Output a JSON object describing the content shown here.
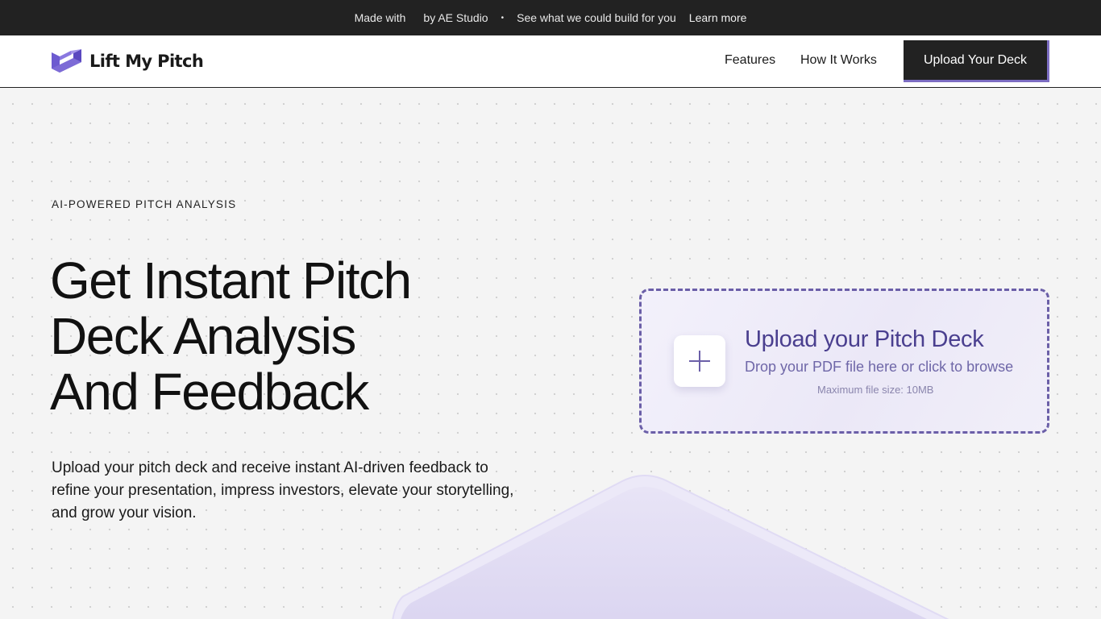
{
  "topbar": {
    "made_with": "Made with",
    "by": "by AE Studio",
    "separator": "•",
    "cta": "See what we could build for you",
    "learn_more": "Learn more"
  },
  "nav": {
    "logo_text": "Lift My Pitch",
    "links": [
      "Features",
      "How It Works"
    ],
    "upload_button": "Upload Your Deck"
  },
  "hero": {
    "eyebrow": "AI-POWERED PITCH ANALYSIS",
    "headline_lines": [
      "Get Instant Pitch",
      "Deck Analysis",
      "And Feedback"
    ],
    "subtext": "Upload your pitch deck and receive instant AI-driven feedback to refine your presentation, impress investors, elevate your storytelling, and grow your vision."
  },
  "upload_card": {
    "title": "Upload your Pitch Deck",
    "subtitle": "Drop your PDF file here or click to browse",
    "max_size": "Maximum file size: 10MB",
    "icon": "plus-icon"
  },
  "colors": {
    "topbar_bg": "#222222",
    "accent": "#6b5fa8",
    "logo_purple": "#6d5bd0",
    "page_bg": "#f4f4f4"
  }
}
